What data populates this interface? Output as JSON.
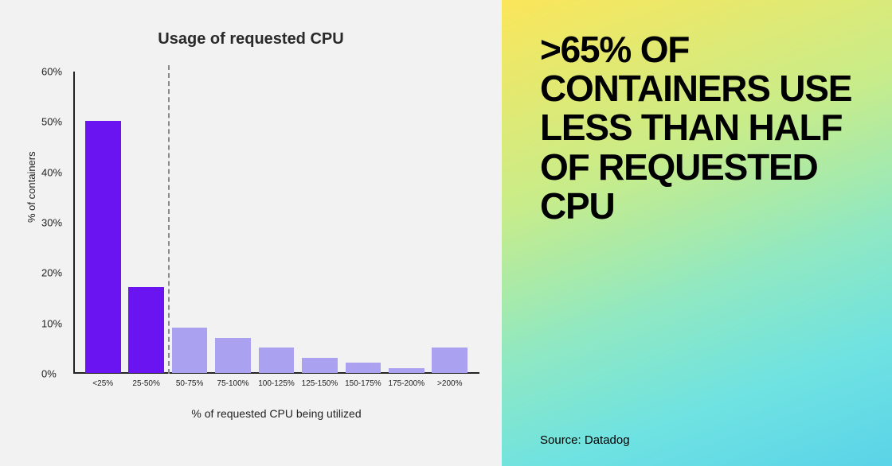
{
  "headline": ">65% OF CONTAINERS USE LESS THAN HALF OF REQUESTED CPU",
  "source_label": "Source: Datadog",
  "chart_data": {
    "type": "bar",
    "title": "Usage of requested CPU",
    "xlabel": "% of requested CPU being utilized",
    "ylabel": "% of containers",
    "ylim": [
      0,
      60
    ],
    "y_ticks": [
      "0%",
      "10%",
      "20%",
      "30%",
      "40%",
      "50%",
      "60%"
    ],
    "categories": [
      "<25%",
      "25-50%",
      "50-75%",
      "75-100%",
      "100-125%",
      "125-150%",
      "150-175%",
      "175-200%",
      ">200%"
    ],
    "values": [
      50,
      17,
      9,
      7,
      5,
      3,
      2,
      1,
      5
    ],
    "emphasized_indices": [
      0,
      1
    ],
    "divider_after_index": 1,
    "colors": {
      "emphasized": "#6b14f2",
      "plain": "#aaa2f0"
    }
  }
}
